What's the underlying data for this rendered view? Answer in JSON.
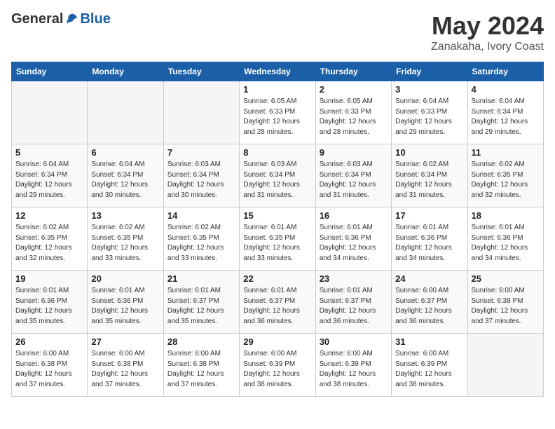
{
  "header": {
    "logo_general": "General",
    "logo_blue": "Blue",
    "main_title": "May 2024",
    "subtitle": "Zanakaha, Ivory Coast"
  },
  "calendar": {
    "weekdays": [
      "Sunday",
      "Monday",
      "Tuesday",
      "Wednesday",
      "Thursday",
      "Friday",
      "Saturday"
    ],
    "weeks": [
      [
        {
          "day": "",
          "info": ""
        },
        {
          "day": "",
          "info": ""
        },
        {
          "day": "",
          "info": ""
        },
        {
          "day": "1",
          "info": "Sunrise: 6:05 AM\nSunset: 6:33 PM\nDaylight: 12 hours\nand 28 minutes."
        },
        {
          "day": "2",
          "info": "Sunrise: 6:05 AM\nSunset: 6:33 PM\nDaylight: 12 hours\nand 28 minutes."
        },
        {
          "day": "3",
          "info": "Sunrise: 6:04 AM\nSunset: 6:33 PM\nDaylight: 12 hours\nand 29 minutes."
        },
        {
          "day": "4",
          "info": "Sunrise: 6:04 AM\nSunset: 6:34 PM\nDaylight: 12 hours\nand 29 minutes."
        }
      ],
      [
        {
          "day": "5",
          "info": "Sunrise: 6:04 AM\nSunset: 6:34 PM\nDaylight: 12 hours\nand 29 minutes."
        },
        {
          "day": "6",
          "info": "Sunrise: 6:04 AM\nSunset: 6:34 PM\nDaylight: 12 hours\nand 30 minutes."
        },
        {
          "day": "7",
          "info": "Sunrise: 6:03 AM\nSunset: 6:34 PM\nDaylight: 12 hours\nand 30 minutes."
        },
        {
          "day": "8",
          "info": "Sunrise: 6:03 AM\nSunset: 6:34 PM\nDaylight: 12 hours\nand 31 minutes."
        },
        {
          "day": "9",
          "info": "Sunrise: 6:03 AM\nSunset: 6:34 PM\nDaylight: 12 hours\nand 31 minutes."
        },
        {
          "day": "10",
          "info": "Sunrise: 6:02 AM\nSunset: 6:34 PM\nDaylight: 12 hours\nand 31 minutes."
        },
        {
          "day": "11",
          "info": "Sunrise: 6:02 AM\nSunset: 6:35 PM\nDaylight: 12 hours\nand 32 minutes."
        }
      ],
      [
        {
          "day": "12",
          "info": "Sunrise: 6:02 AM\nSunset: 6:35 PM\nDaylight: 12 hours\nand 32 minutes."
        },
        {
          "day": "13",
          "info": "Sunrise: 6:02 AM\nSunset: 6:35 PM\nDaylight: 12 hours\nand 33 minutes."
        },
        {
          "day": "14",
          "info": "Sunrise: 6:02 AM\nSunset: 6:35 PM\nDaylight: 12 hours\nand 33 minutes."
        },
        {
          "day": "15",
          "info": "Sunrise: 6:01 AM\nSunset: 6:35 PM\nDaylight: 12 hours\nand 33 minutes."
        },
        {
          "day": "16",
          "info": "Sunrise: 6:01 AM\nSunset: 6:36 PM\nDaylight: 12 hours\nand 34 minutes."
        },
        {
          "day": "17",
          "info": "Sunrise: 6:01 AM\nSunset: 6:36 PM\nDaylight: 12 hours\nand 34 minutes."
        },
        {
          "day": "18",
          "info": "Sunrise: 6:01 AM\nSunset: 6:36 PM\nDaylight: 12 hours\nand 34 minutes."
        }
      ],
      [
        {
          "day": "19",
          "info": "Sunrise: 6:01 AM\nSunset: 6:36 PM\nDaylight: 12 hours\nand 35 minutes."
        },
        {
          "day": "20",
          "info": "Sunrise: 6:01 AM\nSunset: 6:36 PM\nDaylight: 12 hours\nand 35 minutes."
        },
        {
          "day": "21",
          "info": "Sunrise: 6:01 AM\nSunset: 6:37 PM\nDaylight: 12 hours\nand 35 minutes."
        },
        {
          "day": "22",
          "info": "Sunrise: 6:01 AM\nSunset: 6:37 PM\nDaylight: 12 hours\nand 36 minutes."
        },
        {
          "day": "23",
          "info": "Sunrise: 6:01 AM\nSunset: 6:37 PM\nDaylight: 12 hours\nand 36 minutes."
        },
        {
          "day": "24",
          "info": "Sunrise: 6:00 AM\nSunset: 6:37 PM\nDaylight: 12 hours\nand 36 minutes."
        },
        {
          "day": "25",
          "info": "Sunrise: 6:00 AM\nSunset: 6:38 PM\nDaylight: 12 hours\nand 37 minutes."
        }
      ],
      [
        {
          "day": "26",
          "info": "Sunrise: 6:00 AM\nSunset: 6:38 PM\nDaylight: 12 hours\nand 37 minutes."
        },
        {
          "day": "27",
          "info": "Sunrise: 6:00 AM\nSunset: 6:38 PM\nDaylight: 12 hours\nand 37 minutes."
        },
        {
          "day": "28",
          "info": "Sunrise: 6:00 AM\nSunset: 6:38 PM\nDaylight: 12 hours\nand 37 minutes."
        },
        {
          "day": "29",
          "info": "Sunrise: 6:00 AM\nSunset: 6:39 PM\nDaylight: 12 hours\nand 38 minutes."
        },
        {
          "day": "30",
          "info": "Sunrise: 6:00 AM\nSunset: 6:39 PM\nDaylight: 12 hours\nand 38 minutes."
        },
        {
          "day": "31",
          "info": "Sunrise: 6:00 AM\nSunset: 6:39 PM\nDaylight: 12 hours\nand 38 minutes."
        },
        {
          "day": "",
          "info": ""
        }
      ]
    ]
  }
}
